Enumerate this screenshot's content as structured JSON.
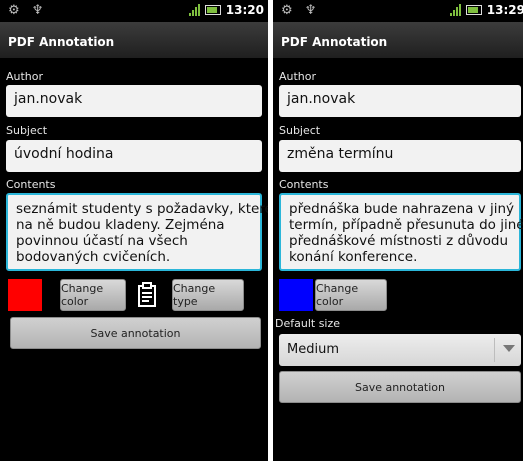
{
  "left": {
    "time": "13:20",
    "title": "PDF Annotation",
    "author_label": "Author",
    "author_value": "jan.novak",
    "subject_label": "Subject",
    "subject_value": "úvodní hodina",
    "contents_label": "Contents",
    "contents_lines": [
      "seznámit studenty s požadavky, které",
      "na ně budou kladeny. Zejména",
      "povinnou účastí na všech",
      "bodovaných cvičeních."
    ],
    "color": "#ff0000",
    "change_color_label": "Change color",
    "change_type_label": "Change type",
    "type_icon": "note-icon",
    "save_label": "Save annotation"
  },
  "right": {
    "time": "13:29",
    "title": "PDF Annotation",
    "author_label": "Author",
    "author_value": "jan.novak",
    "subject_label": "Subject",
    "subject_value": "změna termínu",
    "contents_label": "Contents",
    "contents_lines": [
      "přednáška bude nahrazena v jiný",
      "termín, případně přesunuta do jiné",
      "přednáškové místnosti z důvodu",
      "konání konference."
    ],
    "color": "#0000ff",
    "change_color_label": "Change color",
    "default_size_label": "Default size",
    "default_size_value": "Medium",
    "save_label": "Save annotation"
  }
}
